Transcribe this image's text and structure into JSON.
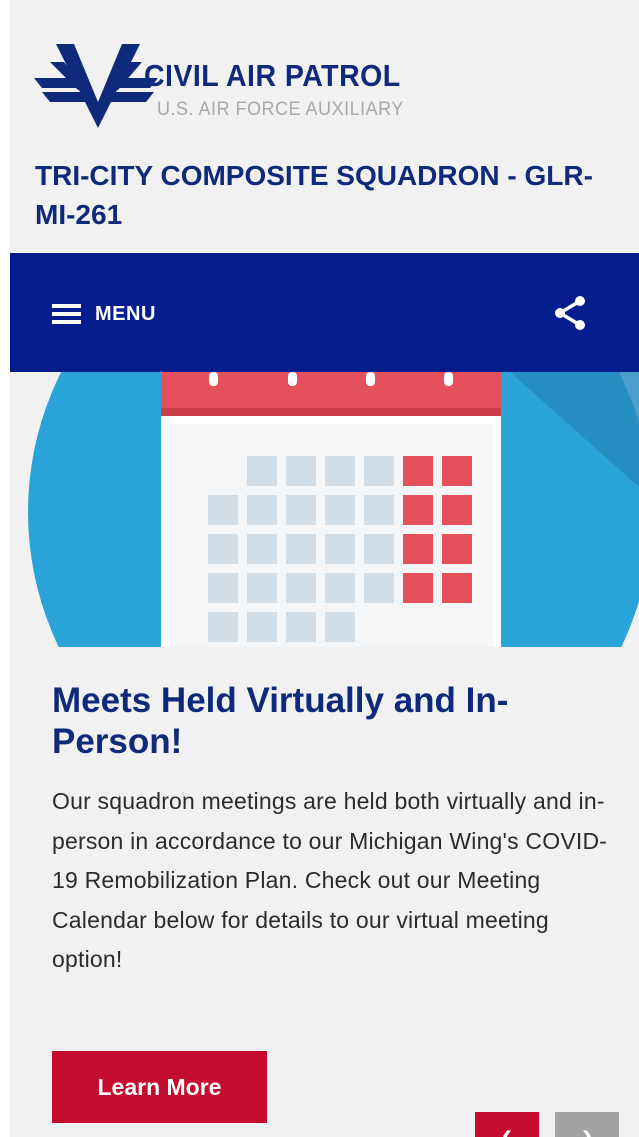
{
  "header": {
    "logo_main": "CIVIL AIR PATROL",
    "logo_sub": "U.S. AIR FORCE AUXILIARY",
    "unit_title": "TRI-CITY COMPOSITE SQUADRON - GLR-MI-261"
  },
  "navbar": {
    "menu_label": "MENU",
    "share_icon": "share-icon"
  },
  "slide": {
    "headline": "Meets Held Virtually and In-Person!",
    "body": "Our squadron meetings are held both virtually and in-person in accordance to our Michigan Wing's COVID-19 Remobilization Plan. Check out our Meeting Calendar below for details to our virtual meeting option!",
    "button_label": "Learn More",
    "prev_label": "‹",
    "next_label": "›"
  },
  "colors": {
    "brand_blue": "#031e8c",
    "title_blue": "#0f2a7a",
    "accent_red": "#c40c2e",
    "hero_circle": "#2aa3d8"
  }
}
